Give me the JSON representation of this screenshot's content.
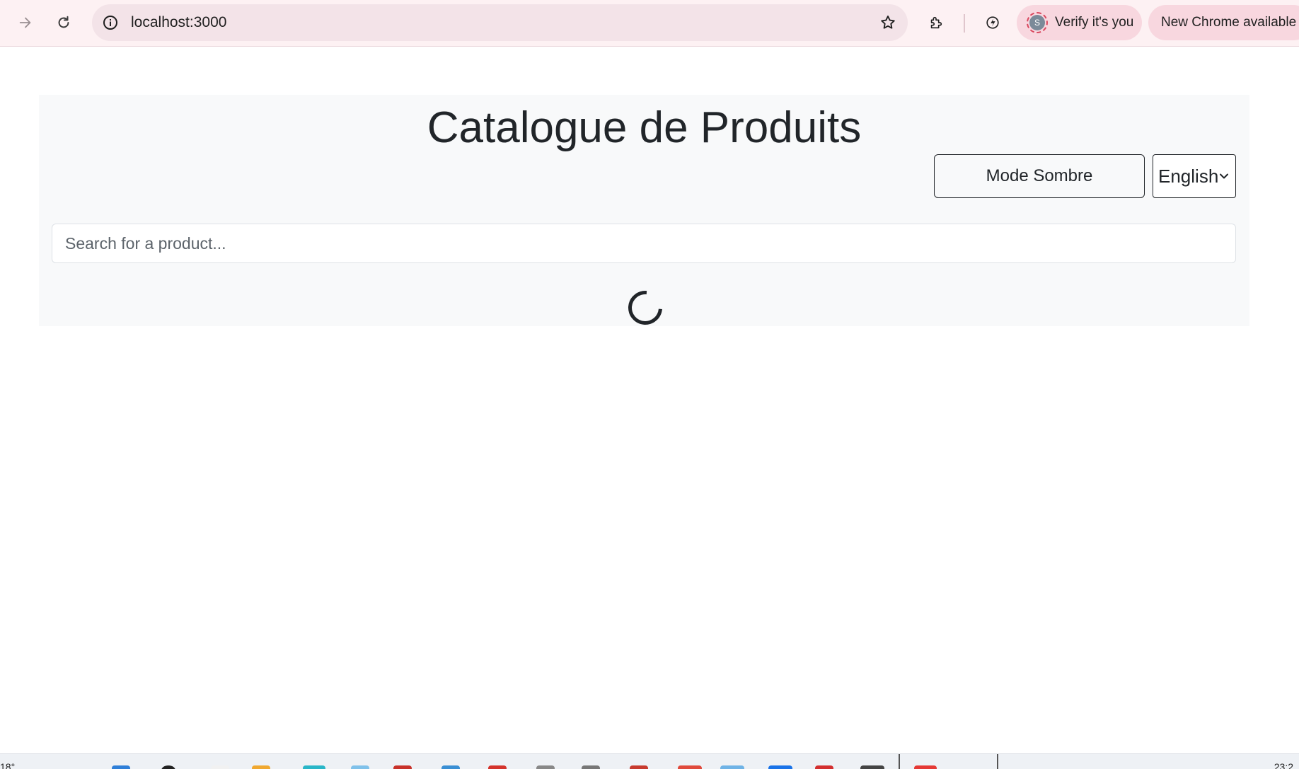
{
  "browser": {
    "url": "localhost:3000",
    "verify_chip": "Verify it's you",
    "avatar_letter": "S",
    "update_chip": "New Chrome available"
  },
  "page": {
    "title": "Catalogue de Produits",
    "mode_button": "Mode Sombre",
    "language": {
      "selected": "English"
    },
    "search": {
      "placeholder": "Search for a product...",
      "value": ""
    },
    "loading": true
  },
  "taskbar": {
    "weather": "18°",
    "clock": "23:2"
  },
  "colors": {
    "toolbar_bg": "#fdf1f3",
    "omnibox_bg": "#f3e3e8",
    "chip_bg": "#f8d7df",
    "panel_bg": "#f8f9fa",
    "text": "#212529"
  }
}
